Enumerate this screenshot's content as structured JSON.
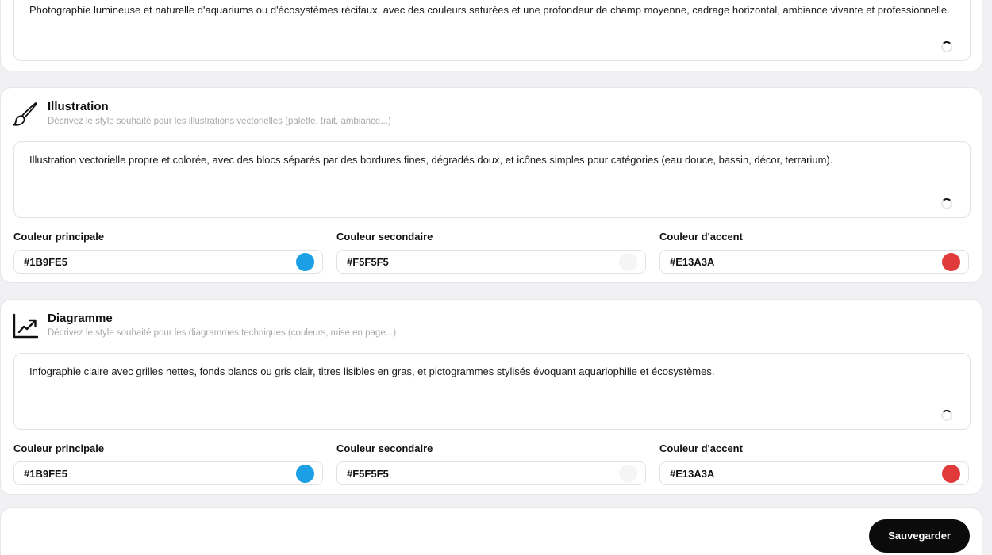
{
  "photo": {
    "text": "Photographie lumineuse et naturelle d'aquariums ou d'écosystèmes récifaux, avec des couleurs saturées et une profondeur de champ moyenne, cadrage horizontal, ambiance vivante et professionnelle."
  },
  "illustration": {
    "title": "Illustration",
    "description": "Décrivez le style souhaité pour les illustrations vectorielles (palette, trait, ambiance...)",
    "text": "Illustration vectorielle propre et colorée, avec des blocs séparés par des bordures fines, dégradés doux, et icônes simples pour catégories (eau douce, bassin, décor, terrarium).",
    "icon": "brush-icon",
    "colors": {
      "primary_label": "Couleur principale",
      "primary_value": "#1B9FE5",
      "secondary_label": "Couleur secondaire",
      "secondary_value": "#F5F5F5",
      "accent_label": "Couleur d'accent",
      "accent_value": "#E13A3A"
    }
  },
  "diagram": {
    "title": "Diagramme",
    "description": "Décrivez le style souhaité pour les diagrammes techniques (couleurs, mise en page...)",
    "text": "Infographie claire avec grilles nettes, fonds blancs ou gris clair, titres lisibles en gras, et pictogrammes stylisés évoquant aquariophilie et écosystèmes.",
    "icon": "trending-chart-icon",
    "colors": {
      "primary_label": "Couleur principale",
      "primary_value": "#1B9FE5",
      "secondary_label": "Couleur secondaire",
      "secondary_value": "#F5F5F5",
      "accent_label": "Couleur d'accent",
      "accent_value": "#E13A3A"
    }
  },
  "actions": {
    "save_label": "Sauvegarder"
  },
  "theme": {
    "primary": "#1B9FE5",
    "secondary": "#F5F5F5",
    "accent": "#E13A3A",
    "button_bg": "#0B0B0B"
  }
}
